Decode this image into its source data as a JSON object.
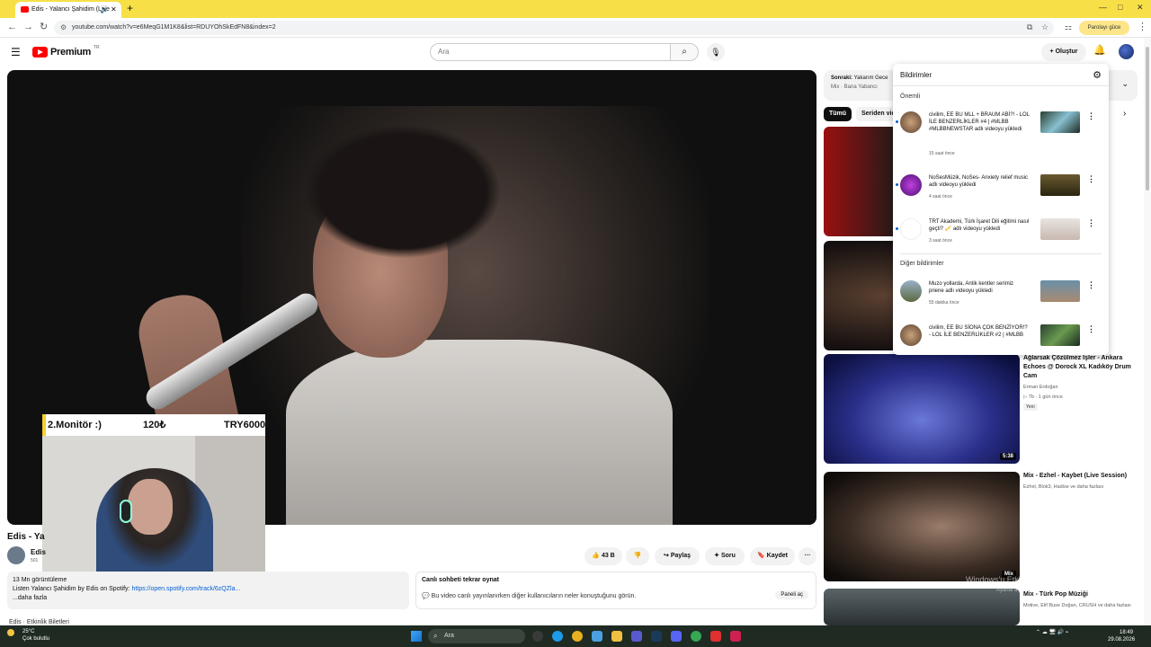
{
  "browser": {
    "tab_title": "Edis - Yalancı Şahidim (Live",
    "address": "youtube.com/watch?v=e6MeqG1M1K8&list=RDUYOhSkEdFN8&index=2",
    "paid_label": "Parolayı güce"
  },
  "header": {
    "logo_text": "Premium",
    "logo_sup": "TR",
    "search_placeholder": "Ara",
    "create_label": "Oluştur"
  },
  "webcam": {
    "left": "2.Monitör :)",
    "mid": "120₺",
    "right": "TRY6000"
  },
  "video": {
    "title": "Edis - Ya",
    "channel": "Edis",
    "subs": "501",
    "likes": "43 B",
    "share": "Paylaş",
    "ask": "Soru",
    "save": "Kaydet",
    "more": "···"
  },
  "description": {
    "line1": "13 Mn görüntüleme",
    "line2": "Listen Yalancı Şahidim by Edis on Spotify:",
    "link": "https://open.spotify.com/track/6zQZla...",
    "more": "...daha fazla"
  },
  "chat": {
    "title": "Canlı sohbeti tekrar oynat",
    "text": "Bu video canlı yayınlanırken diğer kullanıcıların neler konuştuğunu görün.",
    "button": "Paneli aç"
  },
  "tickets": "Edis · Etkinlik Biletleri",
  "up_next": {
    "label": "Sonraki:",
    "title": "Yakarım Gece",
    "sub": "Mix · Bana Yabancı"
  },
  "chips": [
    "Tümü",
    "Seriden vide"
  ],
  "notifications": {
    "title": "Bildirimler",
    "section1": "Önemli",
    "section2": "Diğer bildirimler",
    "items": [
      {
        "text": "civilim, EE BU MLL + BRAUM ABİ?! - LOL İLE BENZERLİKLER #4 | #MLBB #MLBBNEWSTAR adlı videoyu yükledi",
        "time": "15 saat önce"
      },
      {
        "text": "NoSesMüzik, NoSes- Anxiety relief music adlı videoyu yükledi",
        "time": "4 saat önce"
      },
      {
        "text": "TRT Akademi, Türk İşaret Dili eğitimi nasıl geçti? 🎺 adlı videoyu yükledi",
        "time": "3 saat önce"
      },
      {
        "text": "Muzo yollarda, Antik kentler serimiz priene adlı videoyu yükledi",
        "time": "55 dakika önce"
      },
      {
        "text": "civilim, EE BU SİONA ÇOK BENZİYOR!? - LOL İLE BENZERLİKLER #2 | #MLBB",
        "time": ""
      }
    ]
  },
  "recs": [
    {
      "title": "Ağlarsak Çözülmez İşler - Ankara Echoes @ Dorock XL Kadıköy Drum Cam",
      "channel": "Erman Erdoğan",
      "meta": "▷ 7b · 1 gün önce",
      "tag": "Yeni",
      "badge": "5:38"
    },
    {
      "title": "Mix - Ezhel - Kaybet (Live Session)",
      "channel": "Ezhel, Blok3, Hadise ve daha fazlası",
      "badge": "Mix"
    },
    {
      "title": "Mix - Türk Pop Müziği",
      "channel": "Motive, Elif Buse Doğan, CRUSH ve daha fazlası"
    }
  ],
  "watermark": {
    "line1": "Windows'u Etkinleştir",
    "line2": "Ayarlar'a gidin"
  },
  "taskbar": {
    "temp": "25°C",
    "weather": "Çok bulutlu",
    "search": "Ara",
    "time": "18:49",
    "date": "29.08.2026"
  },
  "colors": {
    "accent": "#ff0000",
    "link": "#065fd4",
    "tabbar": "#f7e047"
  }
}
